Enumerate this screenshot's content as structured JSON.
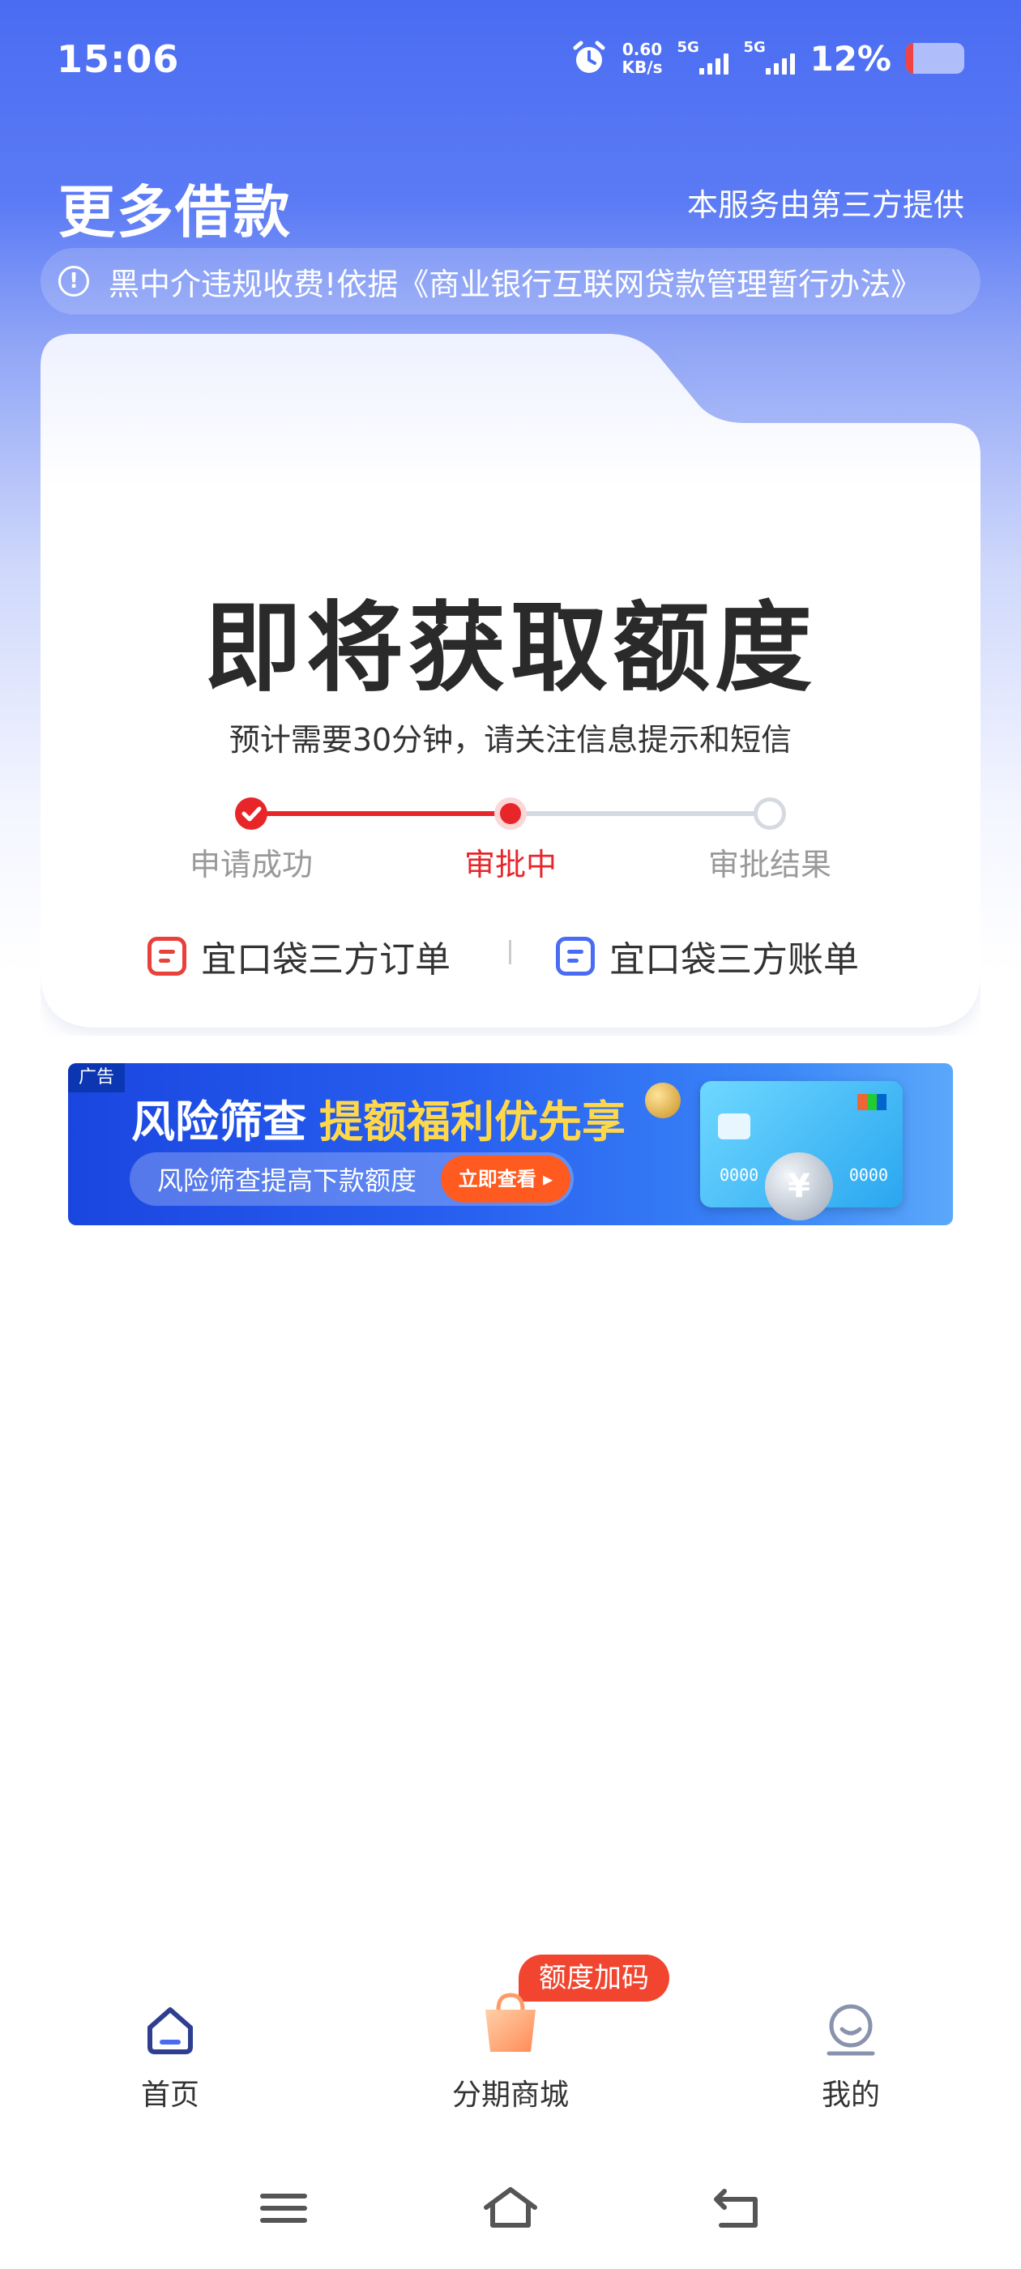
{
  "status_bar": {
    "time": "15:06",
    "net_speed_value": "0.60",
    "net_speed_unit": "KB/s",
    "signal1_tag": "5G",
    "signal2_tag": "5G",
    "battery_percent": "12%",
    "battery_level": 0.12
  },
  "header": {
    "title": "更多借款",
    "provider_note": "本服务由第三方提供"
  },
  "notice": {
    "text": "黑中介违规收费!依据《商业银行互联网贷款管理暂行办法》"
  },
  "status_card": {
    "headline": "即将获取额度",
    "subtitle": "预计需要30分钟，请关注信息提示和短信",
    "steps": [
      {
        "label": "申请成功",
        "state": "done"
      },
      {
        "label": "审批中",
        "state": "current"
      },
      {
        "label": "审批结果",
        "state": "pending"
      }
    ],
    "links": [
      {
        "label": "宜口袋三方订单",
        "icon": "order-doc-icon"
      },
      {
        "label": "宜口袋三方账单",
        "icon": "bill-doc-icon"
      }
    ]
  },
  "banner": {
    "ad_tag": "广告",
    "title": "风险筛查",
    "highlight": "提额福利优先享",
    "subtitle": "风险筛查提高下款额度",
    "button": "立即查看 ▸",
    "card_number_left": "0000",
    "card_number_right": "0000",
    "coin_symbol": "¥"
  },
  "bottom_nav": {
    "badge": "额度加码",
    "items": [
      {
        "label": "首页",
        "icon": "home-icon"
      },
      {
        "label": "分期商城",
        "icon": "shopping-bag-icon"
      },
      {
        "label": "我的",
        "icon": "profile-icon"
      }
    ]
  },
  "colors": {
    "brand_blue": "#4a6cf2",
    "progress_red": "#e8262a",
    "pending_gray": "#d5d9e2"
  }
}
